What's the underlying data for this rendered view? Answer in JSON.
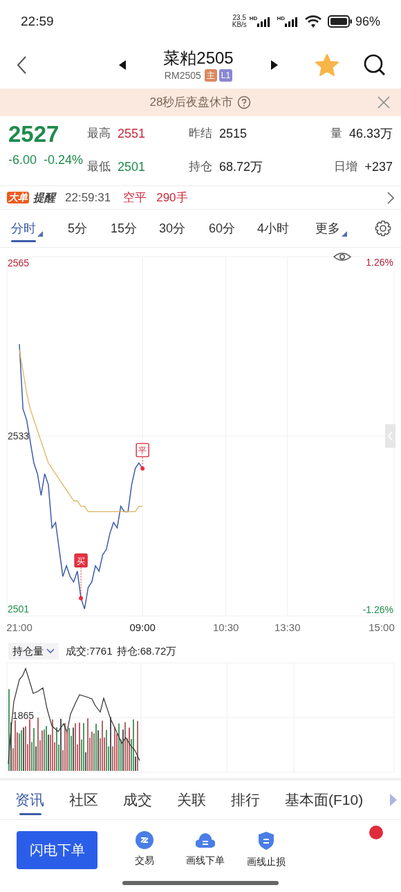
{
  "status_bar": {
    "time": "22:59",
    "net_speed": "23.5",
    "net_unit": "KB/s",
    "sim_labels": [
      "HD",
      "HD"
    ],
    "battery": "96%"
  },
  "header": {
    "title": "菜粕2505",
    "code": "RM2505",
    "badges": [
      {
        "text": "主",
        "color": "#d98a5f"
      },
      {
        "text": "L1",
        "color": "#8b86d0"
      }
    ],
    "favorite": true
  },
  "notice": {
    "text": "28秒后夜盘休市"
  },
  "quote": {
    "price": "2527",
    "change": "-6.00",
    "change_pct": "-0.24%",
    "color": "#1e8b4c",
    "fields": [
      {
        "label": "最高",
        "value": "2551",
        "color": "#c8283c"
      },
      {
        "label": "昨结",
        "value": "2515",
        "color": "#222222"
      },
      {
        "label": "量",
        "value": "46.33万",
        "color": "#222222"
      },
      {
        "label": "最低",
        "value": "2501",
        "color": "#1e8b4c"
      },
      {
        "label": "持仓",
        "value": "68.72万",
        "color": "#222222"
      },
      {
        "label": "日增",
        "value": "+237",
        "color": "#222222"
      }
    ]
  },
  "alert": {
    "tag": "大单",
    "title": "提醒",
    "time": "22:59:31",
    "action": "空平",
    "amount": "290手"
  },
  "periods": [
    {
      "label": "分时",
      "selected": true,
      "has_menu": true
    },
    {
      "label": "5分",
      "selected": false,
      "has_menu": false
    },
    {
      "label": "15分",
      "selected": false,
      "has_menu": false
    },
    {
      "label": "30分",
      "selected": false,
      "has_menu": false
    },
    {
      "label": "60分",
      "selected": false,
      "has_menu": false
    },
    {
      "label": "4小时",
      "selected": false,
      "has_menu": false
    },
    {
      "label": "更多",
      "selected": false,
      "has_menu": true
    }
  ],
  "price_chart": {
    "right_labels": [
      "1.26%",
      "-1.26%"
    ],
    "trade_markers": [
      {
        "text": "买"
      },
      {
        "text": "平"
      }
    ],
    "chart_data": {
      "type": "line",
      "grid": true,
      "ylim": [
        2501,
        2565
      ],
      "yticks": [
        2565,
        2533,
        2501
      ],
      "categories": [
        "21:00",
        null,
        null,
        null,
        null,
        null,
        null,
        null,
        null,
        null,
        null,
        null,
        null,
        null,
        null,
        null,
        null,
        null,
        null,
        null,
        null,
        null,
        null,
        null,
        null,
        null,
        null,
        null,
        null,
        null,
        null,
        null,
        null,
        null,
        "09:00",
        null,
        null,
        null,
        null,
        null,
        null,
        null,
        null,
        null,
        null,
        null,
        null,
        null,
        null,
        null,
        null,
        null,
        null,
        null,
        null,
        null,
        null,
        "10:30",
        null,
        null,
        null,
        null,
        null,
        null,
        null,
        null,
        null,
        null,
        null,
        null,
        null,
        null,
        null,
        null,
        "13:30",
        null,
        null,
        null,
        null,
        null,
        null,
        null,
        null,
        null,
        null,
        null,
        null,
        null,
        null,
        null,
        null,
        null,
        null,
        null,
        null,
        null,
        null,
        null,
        null,
        null,
        "15:00"
      ],
      "series": [
        {
          "color": "#3d5ca8",
          "values": [
            2550,
            2538,
            2536,
            2532,
            2528,
            2526,
            2522,
            2526,
            2524,
            2516,
            2517,
            2512,
            2507,
            2509,
            2507,
            2506,
            2508,
            2503,
            2501,
            2505,
            2506,
            2509,
            2508,
            2511,
            2512,
            2515,
            2517,
            2516,
            2520,
            2519,
            2519,
            2524,
            2527,
            2528,
            2527,
            null,
            null,
            null,
            null,
            null,
            null,
            null,
            null,
            null,
            null,
            null,
            null,
            null,
            null,
            null,
            null,
            null,
            null,
            null,
            null,
            null,
            null,
            null,
            null,
            null,
            null,
            null,
            null,
            null,
            null,
            null,
            null,
            null,
            null,
            null,
            null,
            null,
            null,
            null,
            null,
            null,
            null,
            null,
            null,
            null,
            null,
            null,
            null,
            null,
            null,
            null,
            null,
            null,
            null,
            null,
            null,
            null,
            null,
            null,
            null,
            null,
            null,
            null,
            null,
            null,
            null
          ]
        },
        {
          "color": "#e0b463",
          "values": [
            2549,
            2545,
            2541,
            2538,
            2536,
            2534,
            2532,
            2530,
            2528,
            2527,
            2526,
            2525,
            2524,
            2523,
            2522,
            2521,
            2521,
            2520,
            2520,
            2519,
            2519,
            2519,
            2519,
            2519,
            2519,
            2519,
            2519,
            2519,
            2519,
            2519,
            2519,
            2519,
            2519,
            2520,
            2520,
            null,
            null,
            null,
            null,
            null,
            null,
            null,
            null,
            null,
            null,
            null,
            null,
            null,
            null,
            null,
            null,
            null,
            null,
            null,
            null,
            null,
            null,
            null,
            null,
            null,
            null,
            null,
            null,
            null,
            null,
            null,
            null,
            null,
            null,
            null,
            null,
            null,
            null,
            null,
            null,
            null,
            null,
            null,
            null,
            null,
            null,
            null,
            null,
            null,
            null,
            null,
            null,
            null,
            null,
            null,
            null,
            null,
            null,
            null,
            null,
            null,
            null,
            null,
            null,
            null,
            null
          ]
        }
      ]
    }
  },
  "sub_chart": {
    "indicator": "持仓量",
    "volume": "成交:7761",
    "open_interest": "持仓:68.72万",
    "axis_label": "1865"
  },
  "bottom_tabs": [
    {
      "label": "资讯",
      "selected": true
    },
    {
      "label": "社区",
      "selected": false
    },
    {
      "label": "成交",
      "selected": false
    },
    {
      "label": "关联",
      "selected": false
    },
    {
      "label": "排行",
      "selected": false
    },
    {
      "label": "基本面(F10)",
      "selected": false
    }
  ],
  "actions": {
    "primary": "闪电下单",
    "items": [
      {
        "label": "交易",
        "kind": "trade"
      },
      {
        "label": "画线下单",
        "kind": "cloud"
      },
      {
        "label": "画线止损",
        "kind": "shield"
      }
    ],
    "has_badge": true
  }
}
